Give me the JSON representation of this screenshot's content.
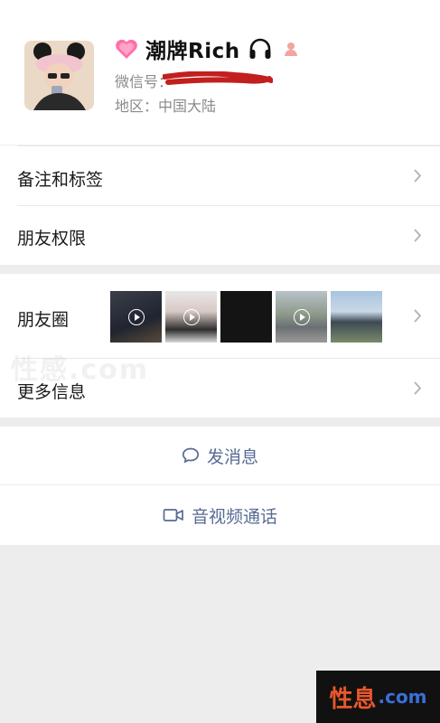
{
  "profile": {
    "name": "潮牌Rich",
    "wechat_id_label": "微信号：",
    "region": "地区：中国大陆",
    "icons": [
      "pink-heart-icon",
      "headphones-icon",
      "person-icon"
    ]
  },
  "rows": {
    "remark_tags": "备注和标签",
    "friend_permissions": "朋友权限",
    "moments": "朋友圈",
    "more_info": "更多信息"
  },
  "actions": {
    "send_message": "发消息",
    "video_call": "音视频通话"
  },
  "watermark": {
    "text": "性感.com",
    "brand_cn": "性息",
    "brand_domain": ".com"
  },
  "colors": {
    "link_blue": "#576b95",
    "background_gray": "#ededed"
  }
}
